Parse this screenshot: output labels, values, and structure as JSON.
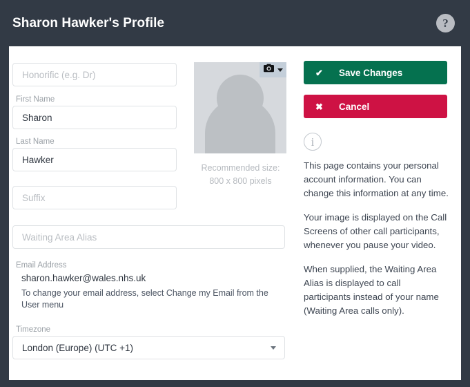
{
  "header": {
    "title": "Sharon Hawker's Profile",
    "help_icon": "question-mark-icon",
    "help_label": "?",
    "background_color": "#323a45"
  },
  "form": {
    "honorific": {
      "label": "",
      "placeholder": "Honorific (e.g. Dr)",
      "value": ""
    },
    "first_name": {
      "label": "First Name",
      "placeholder": "",
      "value": "Sharon"
    },
    "last_name": {
      "label": "Last Name",
      "placeholder": "",
      "value": "Hawker"
    },
    "suffix": {
      "label": "",
      "placeholder": "Suffix",
      "value": ""
    },
    "waiting_area_alias": {
      "label": "",
      "placeholder": "Waiting Area Alias",
      "value": ""
    },
    "email": {
      "label": "Email Address",
      "value": "sharon.hawker@wales.nhs.uk",
      "hint": "To change your email address, select Change my Email from the User menu"
    },
    "timezone": {
      "label": "Timezone",
      "value": "London (Europe) (UTC +1)",
      "caret_icon": "chevron-down-icon"
    }
  },
  "avatar": {
    "placeholder_icon": "person-silhouette-icon",
    "camera_icon": "camera-icon",
    "camera_caret_icon": "chevron-down-icon",
    "note_line_1": "Recommended size:",
    "note_line_2": "800 x 800 pixels"
  },
  "actions": {
    "save": {
      "label": "Save Changes",
      "icon": "check-icon",
      "glyph": "✔",
      "color": "#05714f"
    },
    "cancel": {
      "label": "Cancel",
      "icon": "cross-icon",
      "glyph": "✖",
      "color": "#ce1244"
    }
  },
  "info": {
    "icon": "info-circle-icon",
    "icon_glyph": "i",
    "paragraphs": [
      "This page contains your personal account information. You can change this information at any time.",
      "Your image is displayed on the Call Screens of other call participants, whenever you pause your video.",
      "When supplied, the Waiting Area Alias is displayed to call participants instead of your name (Waiting Area calls only)."
    ]
  }
}
